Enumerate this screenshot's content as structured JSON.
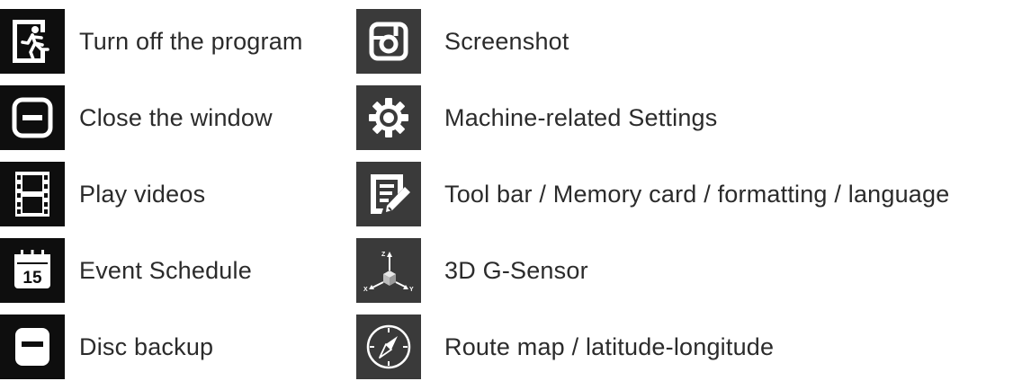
{
  "left_items": [
    {
      "icon": "exit-icon",
      "label": "Turn off the program"
    },
    {
      "icon": "minimize-window-icon",
      "label": "Close the window"
    },
    {
      "icon": "film-strip-icon",
      "label": "Play videos"
    },
    {
      "icon": "calendar-icon",
      "label": "Event Schedule"
    },
    {
      "icon": "floppy-disk-icon",
      "label": "Disc backup"
    }
  ],
  "right_items": [
    {
      "icon": "camera-icon",
      "label": "Screenshot"
    },
    {
      "icon": "gear-icon",
      "label": "Machine-related Settings"
    },
    {
      "icon": "edit-document-icon",
      "label": "Tool bar / Memory card / formatting / language"
    },
    {
      "icon": "3d-axes-icon",
      "label": "3D G-Sensor"
    },
    {
      "icon": "compass-icon",
      "label": "Route map / latitude-longitude"
    }
  ],
  "calendar_day": "15",
  "axis_labels": {
    "z": "Z",
    "x": "X",
    "y": "Y"
  },
  "colors": {
    "tile_black": "#0e0e0e",
    "tile_grey": "#3a3a3a",
    "icon": "#ffffff",
    "text": "#2b2b2b"
  }
}
